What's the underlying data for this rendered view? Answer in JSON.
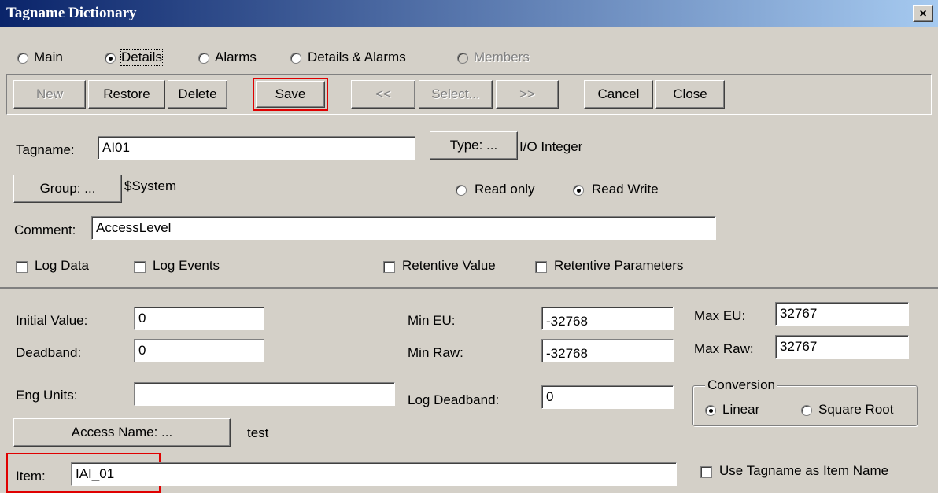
{
  "window": {
    "title": "Tagname Dictionary",
    "close_glyph": "×"
  },
  "view_options": {
    "main": "Main",
    "details": "Details",
    "alarms": "Alarms",
    "details_alarms": "Details & Alarms",
    "members": "Members",
    "selected": "details"
  },
  "toolbar": {
    "new": "New",
    "restore": "Restore",
    "delete": "Delete",
    "save": "Save",
    "prev": "<<",
    "select": "Select...",
    "next": ">>",
    "cancel": "Cancel",
    "close": "Close"
  },
  "tag": {
    "tagname_label": "Tagname:",
    "tagname_value": "AI01",
    "type_button": "Type: ...",
    "type_value": "I/O Integer",
    "group_button": "Group: ...",
    "group_value": "$System",
    "read_only": "Read only",
    "read_write": "Read Write",
    "access_selected": "read_write",
    "comment_label": "Comment:",
    "comment_value": "AccessLevel",
    "log_data": "Log Data",
    "log_events": "Log Events",
    "retentive_value": "Retentive Value",
    "retentive_parameters": "Retentive Parameters"
  },
  "details": {
    "initial_value_label": "Initial Value:",
    "initial_value": "0",
    "deadband_label": "Deadband:",
    "deadband": "0",
    "eng_units_label": "Eng Units:",
    "eng_units": "",
    "min_eu_label": "Min EU:",
    "min_eu": "-32768",
    "min_raw_label": "Min Raw:",
    "min_raw": "-32768",
    "log_deadband_label": "Log Deadband:",
    "log_deadband": "0",
    "max_eu_label": "Max EU:",
    "max_eu": "32767",
    "max_raw_label": "Max Raw:",
    "max_raw": "32767",
    "conversion_label": "Conversion",
    "linear": "Linear",
    "square_root": "Square Root",
    "conversion_selected": "linear",
    "access_name_button": "Access Name: ...",
    "access_name_value": "test",
    "item_label": "Item:",
    "item_value": "IAI_01",
    "use_tagname": "Use Tagname as Item Name"
  },
  "colors": {
    "titlebar_start": "#0a246a",
    "titlebar_end": "#a6caf0",
    "highlight": "#e00000",
    "face": "#d4d0c8"
  }
}
